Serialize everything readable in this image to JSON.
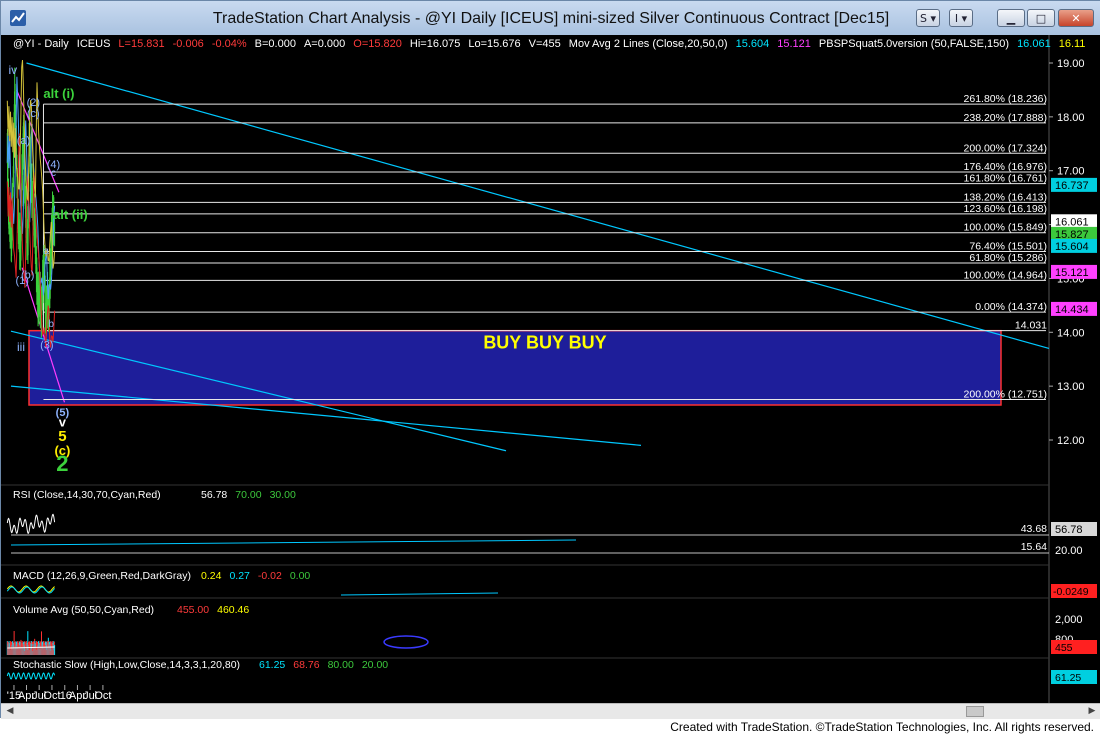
{
  "window": {
    "title": "TradeStation Chart Analysis - @YI Daily [ICEUS] mini-sized Silver Continuous Contract [Dec15]",
    "buttons": [
      "S",
      "I"
    ],
    "footer": "Created with TradeStation. ©TradeStation Technologies, Inc. All rights reserved."
  },
  "header_items": [
    {
      "text": "@YI - Daily",
      "color": "#ffffff"
    },
    {
      "text": "ICEUS",
      "color": "#ffffff"
    },
    {
      "text": "L=15.831",
      "color": "#ff3b3b"
    },
    {
      "text": "-0.006",
      "color": "#ff3b3b"
    },
    {
      "text": "-0.04%",
      "color": "#ff3b3b"
    },
    {
      "text": "B=0.000",
      "color": "#ffffff"
    },
    {
      "text": "A=0.000",
      "color": "#ffffff"
    },
    {
      "text": "O=15.820",
      "color": "#ff3b3b"
    },
    {
      "text": "Hi=16.075",
      "color": "#ffffff"
    },
    {
      "text": "Lo=15.676",
      "color": "#ffffff"
    },
    {
      "text": "V=455",
      "color": "#ffffff"
    },
    {
      "text": "Mov Avg 2 Lines (Close,20,50,0)",
      "color": "#ffffff"
    },
    {
      "text": "15.604",
      "color": "#00e5ff"
    },
    {
      "text": "15.121",
      "color": "#ff40ff"
    },
    {
      "text": "PBSPSquat5.0version (50,FALSE,150)",
      "color": "#ffffff"
    },
    {
      "text": "16.061",
      "color": "#00e5ff"
    },
    {
      "text": "16.11",
      "color": "#ffff00"
    }
  ],
  "chart_data": {
    "type": "candlestick",
    "title": "@YI Daily [ICEUS] mini-sized Silver Continuous Contract [Dec15]",
    "x_ticks": [
      "'15",
      "Apr",
      "Jul",
      "Oct",
      "'16",
      "Apr",
      "Jul",
      "Oct"
    ],
    "y_ticks": [
      19.0,
      18.0,
      17.0,
      16.0,
      15.0,
      14.0,
      13.0,
      12.0
    ],
    "price_path": [
      17.4,
      16.2,
      16.0,
      15.6,
      16.8,
      18.4,
      17.6,
      16.3,
      15.8,
      15.4,
      16.9,
      17.6,
      16.6,
      15.9,
      15.6,
      17.8,
      16.9,
      16.4,
      16.1,
      15.7,
      14.9,
      14.5,
      14.7,
      14.3,
      14.9,
      15.2,
      14.2,
      14.6,
      14.4,
      15.0,
      15.8,
      16.2,
      15.8
    ],
    "fibonacci_levels": [
      {
        "label": "261.80% (18.236)",
        "value": 18.236
      },
      {
        "label": "238.20% (17.888)",
        "value": 17.888
      },
      {
        "label": "200.00% (17.324)",
        "value": 17.324
      },
      {
        "label": "176.40% (16.976)",
        "value": 16.976
      },
      {
        "label": "161.80% (16.761)",
        "value": 16.761
      },
      {
        "label": "138.20% (16.413)",
        "value": 16.413
      },
      {
        "label": "123.60% (16.198)",
        "value": 16.198
      },
      {
        "label": "100.00% (15.849)",
        "value": 15.849
      },
      {
        "label": "76.40% (15.501)",
        "value": 15.501
      },
      {
        "label": "61.80% (15.286)",
        "value": 15.286
      },
      {
        "label": "100.00% (14.964)",
        "value": 14.964
      },
      {
        "label": "0.00% (14.374)",
        "value": 14.374
      },
      {
        "label": "14.031",
        "value": 14.031
      },
      {
        "label": "200.00% (12.751)",
        "value": 12.751
      }
    ],
    "buy_zone": {
      "label": "BUY BUY BUY",
      "low": 12.65,
      "high": 14.03
    },
    "wave_labels": [
      {
        "text": "iv",
        "color": "#8fb4ff"
      },
      {
        "text": "(2)",
        "color": "#8fb4ff"
      },
      {
        "text": "(c)",
        "color": "#8fb4ff"
      },
      {
        "text": "(a)",
        "color": "#8fb4ff"
      },
      {
        "text": "(1)",
        "color": "#8fb4ff"
      },
      {
        "text": "(b)",
        "color": "#8fb4ff"
      },
      {
        "text": "a",
        "color": "#8fb4ff"
      },
      {
        "text": "b",
        "color": "#8fb4ff"
      },
      {
        "text": "(3)",
        "color": "#8fb4ff"
      },
      {
        "text": "(4)",
        "color": "#8fb4ff"
      },
      {
        "text": "c",
        "color": "#8fb4ff"
      },
      {
        "text": "iii",
        "color": "#8fb4ff"
      },
      {
        "text": "alt (i)",
        "color": "#3cd23c"
      },
      {
        "text": "alt (ii)",
        "color": "#3cd23c"
      },
      {
        "text": "(5)",
        "color": "#8fb4ff"
      },
      {
        "text": "v",
        "color": "#ffffff"
      },
      {
        "text": "5",
        "color": "#ffee00"
      },
      {
        "text": "(c)",
        "color": "#ffee00"
      },
      {
        "text": "2",
        "color": "#3cd23c"
      }
    ],
    "price_badges": [
      {
        "value": "16.737",
        "bg": "#00cfe0",
        "fg": "#000000"
      },
      {
        "value": "16.061",
        "bg": "#ffffff",
        "fg": "#000000"
      },
      {
        "value": "15.827",
        "bg": "#3cc83c",
        "fg": "#000000"
      },
      {
        "value": "15.604",
        "bg": "#00cfe0",
        "fg": "#000000"
      },
      {
        "value": "15.121",
        "bg": "#ff40ff",
        "fg": "#000000"
      },
      {
        "value": "14.434",
        "bg": "#ff40ff",
        "fg": "#000000"
      }
    ]
  },
  "rsi": {
    "label": "RSI (Close,14,30,70,Cyan,Red)",
    "values": [
      {
        "text": "56.78",
        "color": "#ffffff"
      },
      {
        "text": "70.00",
        "color": "#3cc83c"
      },
      {
        "text": "30.00",
        "color": "#3cc83c"
      }
    ],
    "levels": [
      "43.68",
      "15.64"
    ],
    "badge": "56.78",
    "axis": "20.00"
  },
  "macd": {
    "label": "MACD (12,26,9,Green,Red,DarkGray)",
    "values": [
      {
        "text": "0.24",
        "color": "#ffff00"
      },
      {
        "text": "0.27",
        "color": "#00e5ff"
      },
      {
        "text": "-0.02",
        "color": "#ff3b3b"
      },
      {
        "text": "0.00",
        "color": "#3cc83c"
      }
    ],
    "badge": "-0.0249"
  },
  "volume": {
    "label": "Volume Avg (50,50,Cyan,Red)",
    "values": [
      {
        "text": "455.00",
        "color": "#ff3b3b"
      },
      {
        "text": "460.46",
        "color": "#ffff00"
      }
    ],
    "axis": [
      "2,000",
      "800"
    ],
    "badge": "455"
  },
  "stochastic": {
    "label": "Stochastic Slow (High,Low,Close,14,3,3,1,20,80)",
    "values": [
      {
        "text": "61.25",
        "color": "#00e5ff"
      },
      {
        "text": "68.76",
        "color": "#ff3b3b"
      },
      {
        "text": "80.00",
        "color": "#3cc83c"
      },
      {
        "text": "20.00",
        "color": "#3cc83c"
      }
    ],
    "badge": "61.25"
  },
  "colors": {
    "background": "#000000",
    "fib_line": "#e8e8e8",
    "trend_cyan": "#00c8ff",
    "channel_magenta": "#ff3cff",
    "bars": "#3cd23c"
  }
}
